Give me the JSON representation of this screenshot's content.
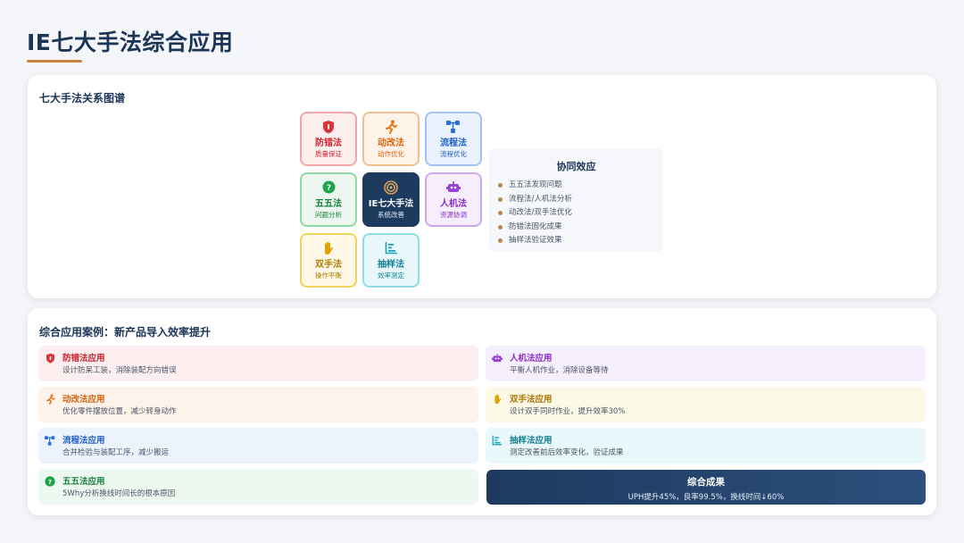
{
  "page": {
    "title": "IE七大手法综合应用"
  },
  "relation": {
    "title": "七大手法关系图谱",
    "tiles": {
      "error_proof": {
        "name": "防错法",
        "sub": "质量保证",
        "icon": "shield-icon",
        "color": "#e0303a"
      },
      "motion": {
        "name": "动改法",
        "sub": "动作优化",
        "icon": "running-icon",
        "color": "#e8731a"
      },
      "flow": {
        "name": "流程法",
        "sub": "流程优化",
        "icon": "flow-icon",
        "color": "#2b6fd6"
      },
      "five_five": {
        "name": "五五法",
        "sub": "问题分析",
        "icon": "question-icon",
        "color": "#1fa34a"
      },
      "center": {
        "name": "IE七大手法",
        "sub": "系统改善",
        "icon": "target-icon",
        "color": "#1d3a5f"
      },
      "man_machine": {
        "name": "人机法",
        "sub": "资源协调",
        "icon": "robot-icon",
        "color": "#9b3fd6"
      },
      "two_hand": {
        "name": "双手法",
        "sub": "操作平衡",
        "icon": "hand-icon",
        "color": "#d9a400"
      },
      "sampling": {
        "name": "抽样法",
        "sub": "效率测定",
        "icon": "chart-icon",
        "color": "#1ba3b8"
      }
    },
    "synergy": {
      "title": "协同效应",
      "items": [
        "五五法发现问题",
        "流程法/人机法分析",
        "动改法/双手法优化",
        "防错法固化成果",
        "抽样法验证效果"
      ]
    }
  },
  "cases": {
    "title": "综合应用案例：新产品导入效率提升",
    "items": [
      {
        "name": "防错法应用",
        "desc": "设计防呆工装，消除装配方向错误"
      },
      {
        "name": "人机法应用",
        "desc": "平衡人机作业，消除设备等待"
      },
      {
        "name": "动改法应用",
        "desc": "优化零件摆放位置，减少转身动作"
      },
      {
        "name": "双手法应用",
        "desc": "设计双手同时作业，提升效率30%"
      },
      {
        "name": "流程法应用",
        "desc": "合并检验与装配工序，减少搬运"
      },
      {
        "name": "抽样法应用",
        "desc": "测定改善前后效率变化，验证成果"
      },
      {
        "name": "五五法应用",
        "desc": "5Why分析换线时间长的根本原因"
      }
    ],
    "result": {
      "title": "综合成果",
      "summary": "UPH提升45%，良率99.5%，换线时间↓60%"
    }
  }
}
